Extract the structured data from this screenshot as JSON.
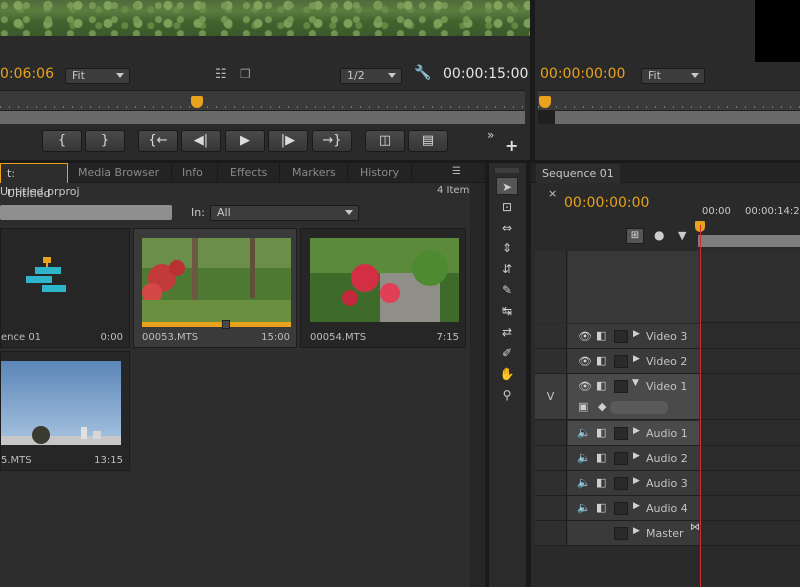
{
  "source_monitor": {
    "current_timecode": "0:06:06",
    "zoom": "Fit",
    "resolution": "1/2",
    "duration": "00:00:15:00",
    "buttons": [
      "{",
      "}",
      "{←",
      "◀|",
      "▶",
      "|▶",
      "→}",
      "insert",
      "overwrite"
    ],
    "more": "»",
    "add": "+"
  },
  "program_monitor": {
    "current_timecode": "00:00:00:00",
    "zoom": "Fit"
  },
  "project_panel": {
    "tabs": [
      "t: Untitled",
      "Media Browser",
      "Info",
      "Effects",
      "Markers",
      "History"
    ],
    "filename": "Untitled.prproj",
    "item_count": "4 Items",
    "in_label": "In:",
    "in_value": "All",
    "items": [
      {
        "name": "ence 01",
        "duration": "0:00"
      },
      {
        "name": "00053.MTS",
        "duration": "15:00"
      },
      {
        "name": "00054.MTS",
        "duration": "7:15"
      },
      {
        "name": "5.MTS",
        "duration": "13:15"
      }
    ]
  },
  "timeline": {
    "tab": "Sequence 01",
    "close": "×",
    "timecode": "00:00:00:00",
    "ruler_labels": [
      "00:00",
      "00:00:14:2"
    ],
    "target_video": "V",
    "tracks": [
      {
        "label": "Video 3"
      },
      {
        "label": "Video 2"
      },
      {
        "label": "Video 1"
      },
      {
        "label": "Audio 1"
      },
      {
        "label": "Audio 2"
      },
      {
        "label": "Audio 3"
      },
      {
        "label": "Audio 4"
      },
      {
        "label": "Master"
      }
    ]
  },
  "colors": {
    "accent": "#e8a21b",
    "playhead": "#d42b2b"
  }
}
